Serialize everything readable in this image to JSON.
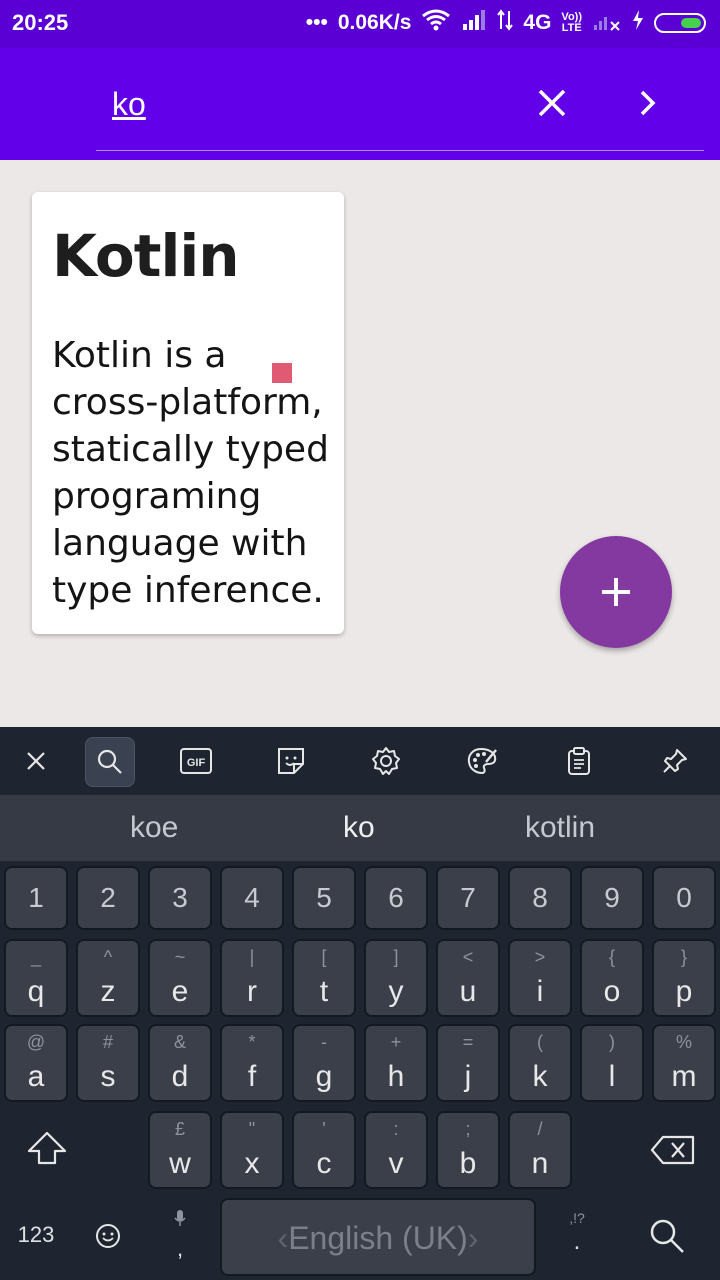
{
  "status_bar": {
    "time": "20:25",
    "dots": "•••",
    "speed": "0.06K/s",
    "network": "4G",
    "volte": "Vo))",
    "lte": "LTE"
  },
  "toolbar": {
    "search_value": "ko"
  },
  "card": {
    "title": "Kotlin",
    "body": "Kotlin is a cross-platform, statically typed programing language with type inference."
  },
  "keyboard": {
    "suggestions": [
      "koe",
      "ko",
      "kotlin"
    ],
    "number_row": [
      "1",
      "2",
      "3",
      "4",
      "5",
      "6",
      "7",
      "8",
      "9",
      "0"
    ],
    "row1": [
      {
        "k": "q",
        "s": "_"
      },
      {
        "k": "z",
        "s": "^"
      },
      {
        "k": "e",
        "s": "~"
      },
      {
        "k": "r",
        "s": "|"
      },
      {
        "k": "t",
        "s": "["
      },
      {
        "k": "y",
        "s": "]"
      },
      {
        "k": "u",
        "s": "<"
      },
      {
        "k": "i",
        "s": ">"
      },
      {
        "k": "o",
        "s": "{"
      },
      {
        "k": "p",
        "s": "}"
      }
    ],
    "row2": [
      {
        "k": "a",
        "s": "@"
      },
      {
        "k": "s",
        "s": "#"
      },
      {
        "k": "d",
        "s": "&"
      },
      {
        "k": "f",
        "s": "*"
      },
      {
        "k": "g",
        "s": "-"
      },
      {
        "k": "h",
        "s": "+"
      },
      {
        "k": "j",
        "s": "="
      },
      {
        "k": "k",
        "s": "("
      },
      {
        "k": "l",
        "s": ")"
      },
      {
        "k": "m",
        "s": "%"
      }
    ],
    "row3": [
      {
        "k": "w",
        "s": "£"
      },
      {
        "k": "x",
        "s": "\""
      },
      {
        "k": "c",
        "s": "'"
      },
      {
        "k": "v",
        "s": ":"
      },
      {
        "k": "b",
        "s": ";"
      },
      {
        "k": "n",
        "s": "/"
      }
    ],
    "numbers_key": "123",
    "comma": ",",
    "space_label": "English (UK)",
    "punct_top": ",!?",
    "punct_main": "."
  }
}
